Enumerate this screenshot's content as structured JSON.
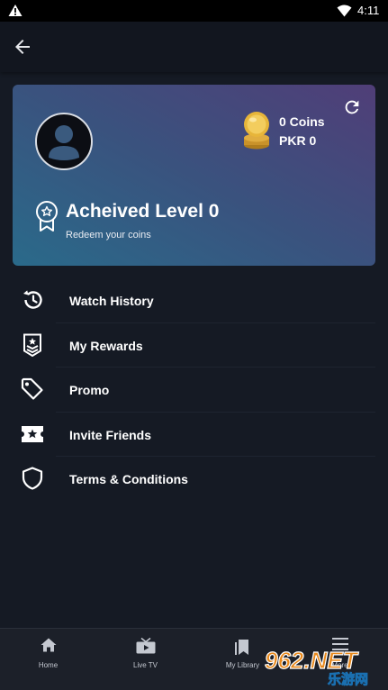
{
  "status_bar": {
    "time": "4:11",
    "icons": [
      "warning-icon",
      "wifi-icon",
      "battery-icon"
    ]
  },
  "app_bar": {
    "back_icon": "arrow-left-icon"
  },
  "profile": {
    "coins": "0 Coins",
    "currency": "PKR 0",
    "level": "Acheived Level 0",
    "subtitle": "Redeem your coins",
    "avatar_icon": "user-avatar-icon",
    "refresh_icon": "refresh-icon",
    "coin_icon": "coin-stack-icon",
    "award_icon": "award-ribbon-icon"
  },
  "menu": {
    "items": [
      {
        "label": "Watch History",
        "icon": "history-icon"
      },
      {
        "label": "My Rewards",
        "icon": "rewards-badge-icon"
      },
      {
        "label": "Promo",
        "icon": "tag-icon"
      },
      {
        "label": "Invite Friends",
        "icon": "ticket-star-icon"
      },
      {
        "label": "Terms & Conditions",
        "icon": "shield-icon"
      }
    ]
  },
  "bottom_nav": {
    "items": [
      {
        "label": "Home",
        "icon": "home-icon"
      },
      {
        "label": "Live TV",
        "icon": "tv-play-icon"
      },
      {
        "label": "My Library",
        "icon": "bookmark-icon"
      },
      {
        "label": "More",
        "icon": "menu-icon"
      }
    ]
  },
  "watermark": {
    "line1": "962.NET",
    "line2": "乐游网"
  },
  "colors": {
    "background": "#151a24",
    "card_gradient_start": "#2a6a8a",
    "card_gradient_end": "#503e78",
    "coin_gold": "#e7b53a"
  }
}
